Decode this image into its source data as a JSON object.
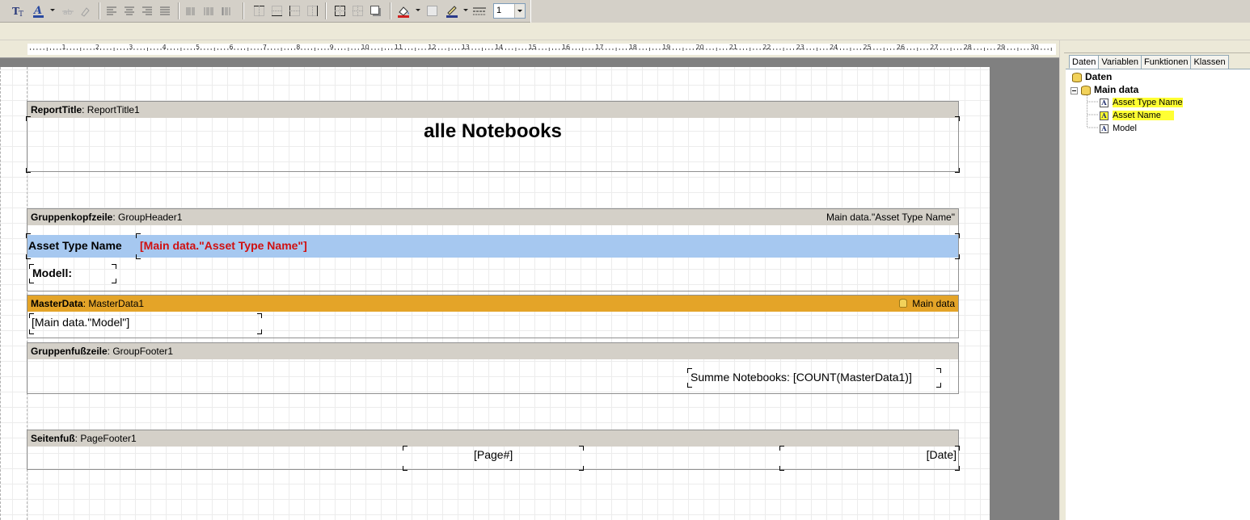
{
  "toolbar": {
    "icons": [
      "text-format-icon",
      "font-color-icon",
      "strikethrough-icon",
      "highlight-icon",
      "align-left-icon",
      "align-center-icon",
      "align-right-icon",
      "justify-icon",
      "barcode-icons",
      "frame-icons",
      "fill-color-icon",
      "line-color-icon",
      "line-style-icon"
    ],
    "line_width": "1"
  },
  "ruler": {
    "numbers": [
      "1",
      "2",
      "3",
      "4",
      "5",
      "6",
      "7",
      "8",
      "9",
      "10",
      "11",
      "12",
      "13",
      "14",
      "15",
      "16",
      "17",
      "18",
      "19",
      "20",
      "21",
      "22",
      "23",
      "24",
      "25",
      "26",
      "27",
      "28",
      "29",
      "30"
    ]
  },
  "bands": {
    "report_title": {
      "type": "ReportTitle",
      "name": "ReportTitle1",
      "text": "alle Notebooks"
    },
    "group_header": {
      "type": "Gruppenkopfzeile",
      "name": "GroupHeader1",
      "condition": "Main data.\"Asset Type Name\"",
      "label": "Asset Type Name",
      "field": "[Main data.\"Asset Type Name\"]",
      "model_label": "Modell:"
    },
    "master_data": {
      "type": "MasterData",
      "name": "MasterData1",
      "source": "Main data",
      "field": "[Main data.\"Model\"]"
    },
    "group_footer": {
      "type": "Gruppenfußzeile",
      "name": "GroupFooter1",
      "sum": "Summe Notebooks: [COUNT(MasterData1)]"
    },
    "page_footer": {
      "type": "Seitenfuß",
      "name": "PageFooter1",
      "page": "[Page#]",
      "date": "[Date]"
    }
  },
  "panel": {
    "tabs": [
      "Daten",
      "Variablen",
      "Funktionen",
      "Klassen"
    ],
    "active_tab": "Daten",
    "tree": {
      "root": "Daten",
      "datasource": "Main data",
      "fields": [
        "Asset Type Name",
        "Asset Name",
        "Model"
      ],
      "highlight_color": "#ffff33"
    }
  },
  "colors": {
    "band_header": "#d4d0c8",
    "master_header": "#e4a428",
    "group_row": "#a6c8f0",
    "group_field": "#d01010"
  }
}
